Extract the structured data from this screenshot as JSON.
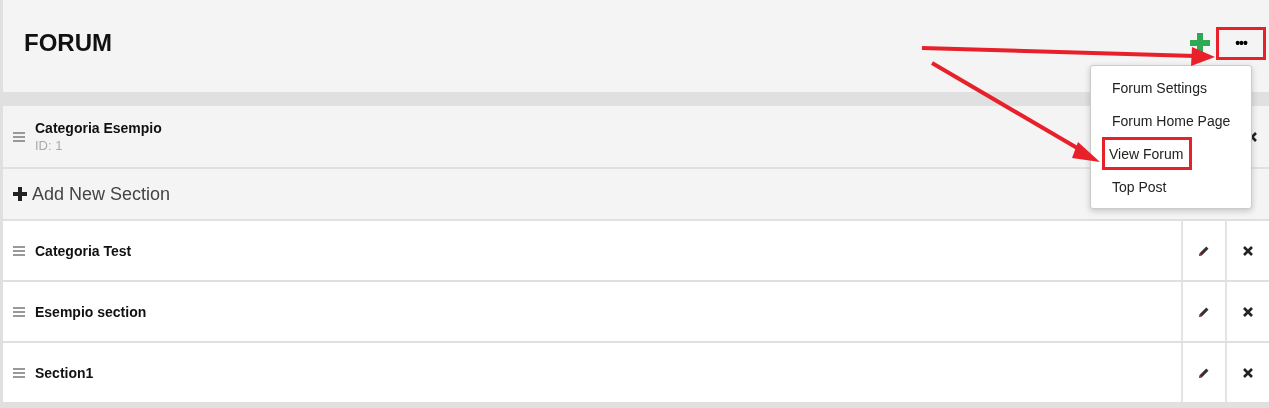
{
  "header": {
    "title": "FORUM",
    "more_button": {
      "label": "•••",
      "highlighted": true
    }
  },
  "menu": {
    "items": [
      {
        "label": "Forum Settings",
        "highlighted": false
      },
      {
        "label": "Forum Home Page",
        "highlighted": false
      },
      {
        "label": "View Forum",
        "highlighted": true
      },
      {
        "label": "Top Post",
        "highlighted": false
      }
    ]
  },
  "category": {
    "name": "Categoria Esempio",
    "id_text": "ID: 1"
  },
  "add_section": {
    "label": "Add New Section"
  },
  "sections": [
    {
      "name": "Categoria Test"
    },
    {
      "name": "Esempio section"
    },
    {
      "name": "Section1"
    }
  ]
}
